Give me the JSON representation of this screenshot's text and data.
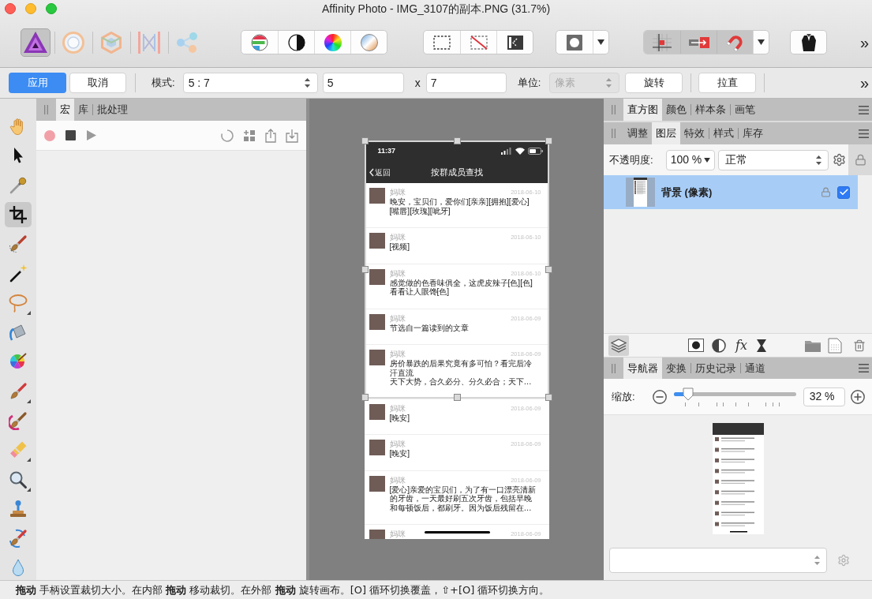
{
  "window": {
    "title": "Affinity Photo - IMG_3107的副本.PNG (31.7%)"
  },
  "toolbar": {
    "personas": [
      {
        "kind": "photo",
        "selected": true
      },
      {
        "kind": "liquify",
        "selected": false
      },
      {
        "kind": "develop",
        "selected": false
      },
      {
        "kind": "tone-mapping",
        "selected": false
      },
      {
        "kind": "export",
        "selected": false
      }
    ],
    "snapping_on": true,
    "overflow": "»"
  },
  "context_bar": {
    "apply": "应用",
    "cancel": "取消",
    "mode_label": "模式:",
    "mode_value": "5 : 7",
    "width_value": "5",
    "times": "x",
    "height_value": "7",
    "unit_label": "单位:",
    "unit_value": "像素",
    "unit_disabled": true,
    "rotate": "旋转",
    "straighten": "拉直",
    "overflow": "»"
  },
  "tools": [
    {
      "kind": "hand",
      "selected": false,
      "submenu": false
    },
    {
      "kind": "pointer",
      "selected": false,
      "submenu": false
    },
    {
      "kind": "eyedropper",
      "selected": false,
      "submenu": false
    },
    {
      "kind": "crop",
      "selected": true,
      "submenu": false
    },
    {
      "kind": "selection-brush",
      "selected": false,
      "submenu": false
    },
    {
      "kind": "magic-wand",
      "selected": false,
      "submenu": false
    },
    {
      "kind": "lasso",
      "selected": false,
      "submenu": true
    },
    {
      "kind": "bucket",
      "selected": false,
      "submenu": false
    },
    {
      "kind": "color-wheel",
      "selected": false,
      "submenu": false
    },
    {
      "kind": "paintbrush",
      "selected": false,
      "submenu": true
    },
    {
      "kind": "swirl-brush",
      "selected": false,
      "submenu": false
    },
    {
      "kind": "eraser",
      "selected": false,
      "submenu": true
    },
    {
      "kind": "magnifier",
      "selected": false,
      "submenu": true
    },
    {
      "kind": "stamp",
      "selected": false,
      "submenu": false
    },
    {
      "kind": "healing-brush",
      "selected": false,
      "submenu": false
    },
    {
      "kind": "droplet",
      "selected": false,
      "submenu": false
    }
  ],
  "macro_panel": {
    "tabs": [
      {
        "label": "宏",
        "selected": true
      },
      {
        "label": "库",
        "selected": false
      },
      {
        "label": "批处理",
        "selected": false
      }
    ]
  },
  "canvas": {
    "phone": {
      "time": "11:37",
      "back": "返回",
      "title": "按群成员查找",
      "messages": [
        {
          "sender": "妈咪",
          "date": "2018-06-10",
          "text": "晚安，宝贝们，爱你们[亲亲][拥抱][爱心][嘴唇][玫瑰][呲牙]"
        },
        {
          "sender": "妈咪",
          "date": "2018-06-10",
          "text": "[视频]"
        },
        {
          "sender": "妈咪",
          "date": "2018-06-10",
          "text": "感觉做的色香味俱全，这虎皮辣子[色][色]看看让人眼馋[色]"
        },
        {
          "sender": "妈咪",
          "date": "2018-06-09",
          "text": "节选自一篇读到的文章"
        },
        {
          "sender": "妈咪",
          "date": "2018-06-09",
          "text": "房价暴跌的后果究竟有多可怕？看完后冷汗直流",
          "summary": "天下大势，合久必分、分久必合；天下…"
        },
        {
          "sender": "妈咪",
          "date": "2018-06-09",
          "text": "[晚安]"
        },
        {
          "sender": "妈咪",
          "date": "2018-06-09",
          "text": "[晚安]"
        },
        {
          "sender": "妈咪",
          "date": "2018-06-09",
          "text": "[爱心]亲爱的宝贝们，为了有一口漂亮清新的牙齿，一天最好刷五次牙齿，包括早晚和每顿饭后，都刷牙。因为饭后残留在…"
        },
        {
          "sender": "妈咪",
          "date": "2018-06-09"
        }
      ]
    }
  },
  "histogram_panel": {
    "tabs": [
      {
        "label": "直方图",
        "selected": true
      },
      {
        "label": "颜色",
        "selected": false
      },
      {
        "label": "样本条",
        "selected": false
      },
      {
        "label": "画笔",
        "selected": false
      }
    ]
  },
  "layers_panel": {
    "tabs": [
      {
        "label": "调整",
        "selected": false
      },
      {
        "label": "图层",
        "selected": true
      },
      {
        "label": "特效",
        "selected": false
      },
      {
        "label": "样式",
        "selected": false
      },
      {
        "label": "库存",
        "selected": false
      }
    ],
    "opacity_label": "不透明度:",
    "opacity_value": "100 %",
    "blend_mode": "正常",
    "layers": [
      {
        "name": "背景 (像素)",
        "selected": true,
        "locked": true,
        "visible": true
      }
    ],
    "fx": "fx"
  },
  "navigator_panel": {
    "tabs": [
      {
        "label": "导航器",
        "selected": true
      },
      {
        "label": "变换",
        "selected": false
      },
      {
        "label": "历史记录",
        "selected": false
      },
      {
        "label": "通道",
        "selected": false
      }
    ],
    "zoom_label": "缩放:",
    "level": 0.12,
    "zoom_value": "32 %"
  },
  "status_bar": {
    "hint": "**拖动** 手柄设置裁切大小。在内部 **拖动** 移动裁切。在外部 **拖动** 旋转画布。[O] 循环切换覆盖，⇧+[O] 循环切换方向。"
  }
}
